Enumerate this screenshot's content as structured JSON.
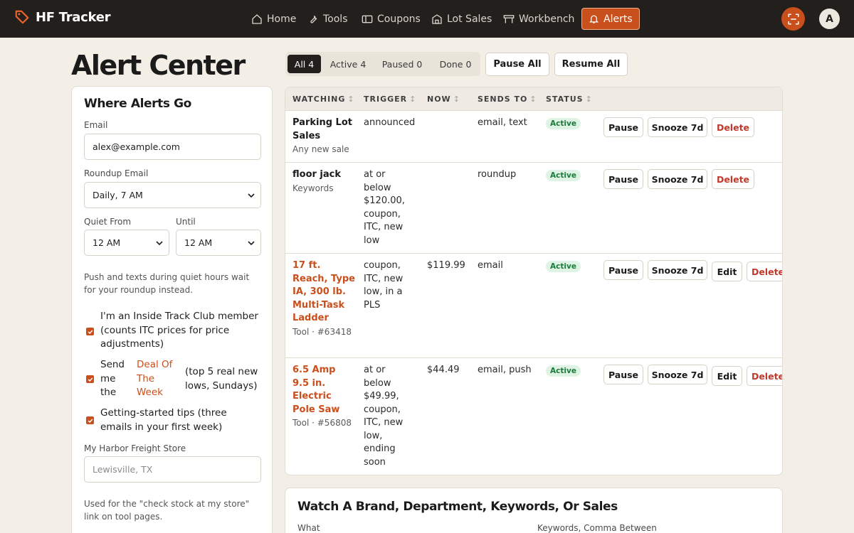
{
  "brand": {
    "name": "HF Tracker"
  },
  "nav": [
    {
      "label": "Home",
      "icon": "home-icon"
    },
    {
      "label": "Tools",
      "icon": "wrench-icon"
    },
    {
      "label": "Coupons",
      "icon": "ticket-icon"
    },
    {
      "label": "Lot Sales",
      "icon": "store-icon"
    },
    {
      "label": "Workbench",
      "icon": "workbench-icon"
    },
    {
      "label": "Alerts",
      "icon": "bell-icon",
      "active": true
    }
  ],
  "user": {
    "avatar_letter": "A"
  },
  "page": {
    "title": "Alert Center"
  },
  "filters": [
    {
      "label": "All 4",
      "active": true
    },
    {
      "label": "Active 4"
    },
    {
      "label": "Paused 0"
    },
    {
      "label": "Done 0"
    }
  ],
  "actions": {
    "pause_all": "Pause All",
    "resume_all": "Resume All"
  },
  "settings": {
    "heading": "Where Alerts Go",
    "email_label": "Email",
    "email_value": "alex@example.com",
    "roundup_label": "Roundup Email",
    "roundup_value": "Daily, 7 AM",
    "quiet_from_label": "Quiet From",
    "quiet_from_value": "12 AM",
    "until_label": "Until",
    "until_value": "12 AM",
    "quiet_hint": "Push and texts during quiet hours wait for your roundup instead.",
    "itc_label": "I'm an Inside Track Club member (counts ITC prices for price adjustments)",
    "deal_send": "Send me the",
    "deal_link": "Deal Of The Week",
    "deal_suffix": "(top 5 real new lows, Sundays)",
    "tips_label": "Getting-started tips (three emails in your first week)",
    "store_label": "My Harbor Freight Store",
    "store_placeholder": "Lewisville, TX",
    "store_hint": "Used for the \"check stock at my store\" link on tool pages."
  },
  "table": {
    "columns": [
      "WATCHING",
      "TRIGGER",
      "NOW",
      "SENDS TO",
      "STATUS"
    ],
    "rows": [
      {
        "name": "Parking Lot Sales",
        "sub": "Any new sale",
        "trigger": "announced",
        "now": "",
        "sends_to": "email, text",
        "status": "Active",
        "buttons": [
          "Pause",
          "Snooze 7d",
          "Delete"
        ]
      },
      {
        "name": "floor jack",
        "sub": "Keywords",
        "trigger": "at or below $120.00, coupon, ITC, new low",
        "now": "",
        "sends_to": "roundup",
        "status": "Active",
        "buttons": [
          "Pause",
          "Snooze 7d",
          "Delete"
        ]
      },
      {
        "name": "17 ft. Reach, Type IA, 300 lb. Multi-Task Ladder",
        "sub": "Tool · #63418",
        "trigger": "coupon, ITC, new low, in a PLS",
        "now": "$119.99",
        "sends_to": "email",
        "status": "Active",
        "buttons": [
          "Pause",
          "Snooze 7d",
          "Edit",
          "Delete"
        ]
      },
      {
        "name": "6.5 Amp 9.5 in. Electric Pole Saw",
        "sub": "Tool · #56808",
        "trigger": "at or below $49.99, coupon, ITC, new low, ending soon",
        "now": "$44.49",
        "sends_to": "email, push",
        "status": "Active",
        "buttons": [
          "Pause",
          "Snooze 7d",
          "Edit",
          "Delete"
        ]
      }
    ]
  },
  "watch_form": {
    "heading": "Watch A Brand, Department, Keywords, Or Sales",
    "what_label": "What",
    "keywords_label": "Keywords, Comma Between"
  },
  "colors": {
    "accent": "#c94f1c",
    "topbar": "#231f1c",
    "background": "#f3efe6",
    "active_badge": "#1c7a3a"
  }
}
